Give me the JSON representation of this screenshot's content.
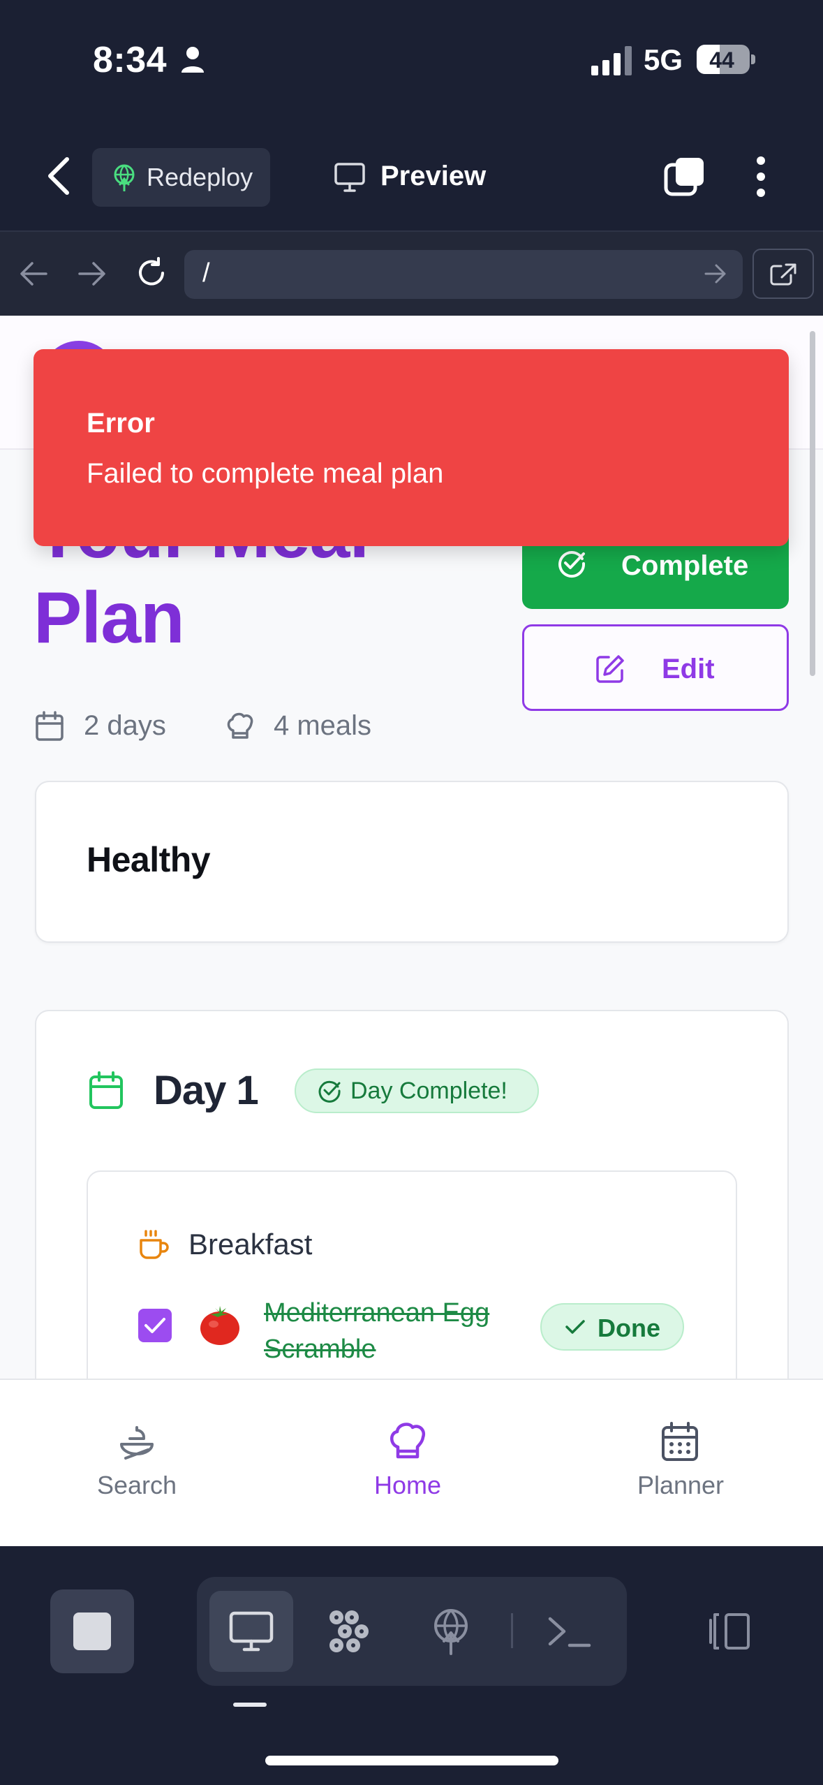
{
  "status_bar": {
    "time": "8:34",
    "network": "5G",
    "battery_level": 44,
    "battery_label": "44"
  },
  "app_header": {
    "redeploy_label": "Redeploy",
    "preview_label": "Preview"
  },
  "browser": {
    "url": "/"
  },
  "page": {
    "title": "Your Meal Plan",
    "complete_label": "Complete",
    "edit_label": "Edit",
    "days_label": "2 days",
    "meals_label": "4 meals",
    "tag": "Healthy"
  },
  "day": {
    "title": "Day 1",
    "badge": "Day Complete!",
    "meal": {
      "type": "Breakfast",
      "name": "Mediterranean Egg Scramble",
      "emoji": "🍅",
      "checked": true,
      "status": "Done"
    }
  },
  "toast": {
    "title": "Error",
    "message": "Failed to complete meal plan"
  },
  "bottom_nav": {
    "items": [
      {
        "label": "Search",
        "icon": "search-bowl-icon",
        "active": false
      },
      {
        "label": "Home",
        "icon": "chef-hat-icon",
        "active": true
      },
      {
        "label": "Planner",
        "icon": "calendar-icon",
        "active": false
      }
    ],
    "active_color": "#8f3ae6",
    "inactive_color": "#6c7380"
  },
  "colors": {
    "accent_purple": "#8f3ae6",
    "success_green": "#15a94a",
    "error_red": "#ef4444",
    "chrome_dark": "#1b2033"
  }
}
